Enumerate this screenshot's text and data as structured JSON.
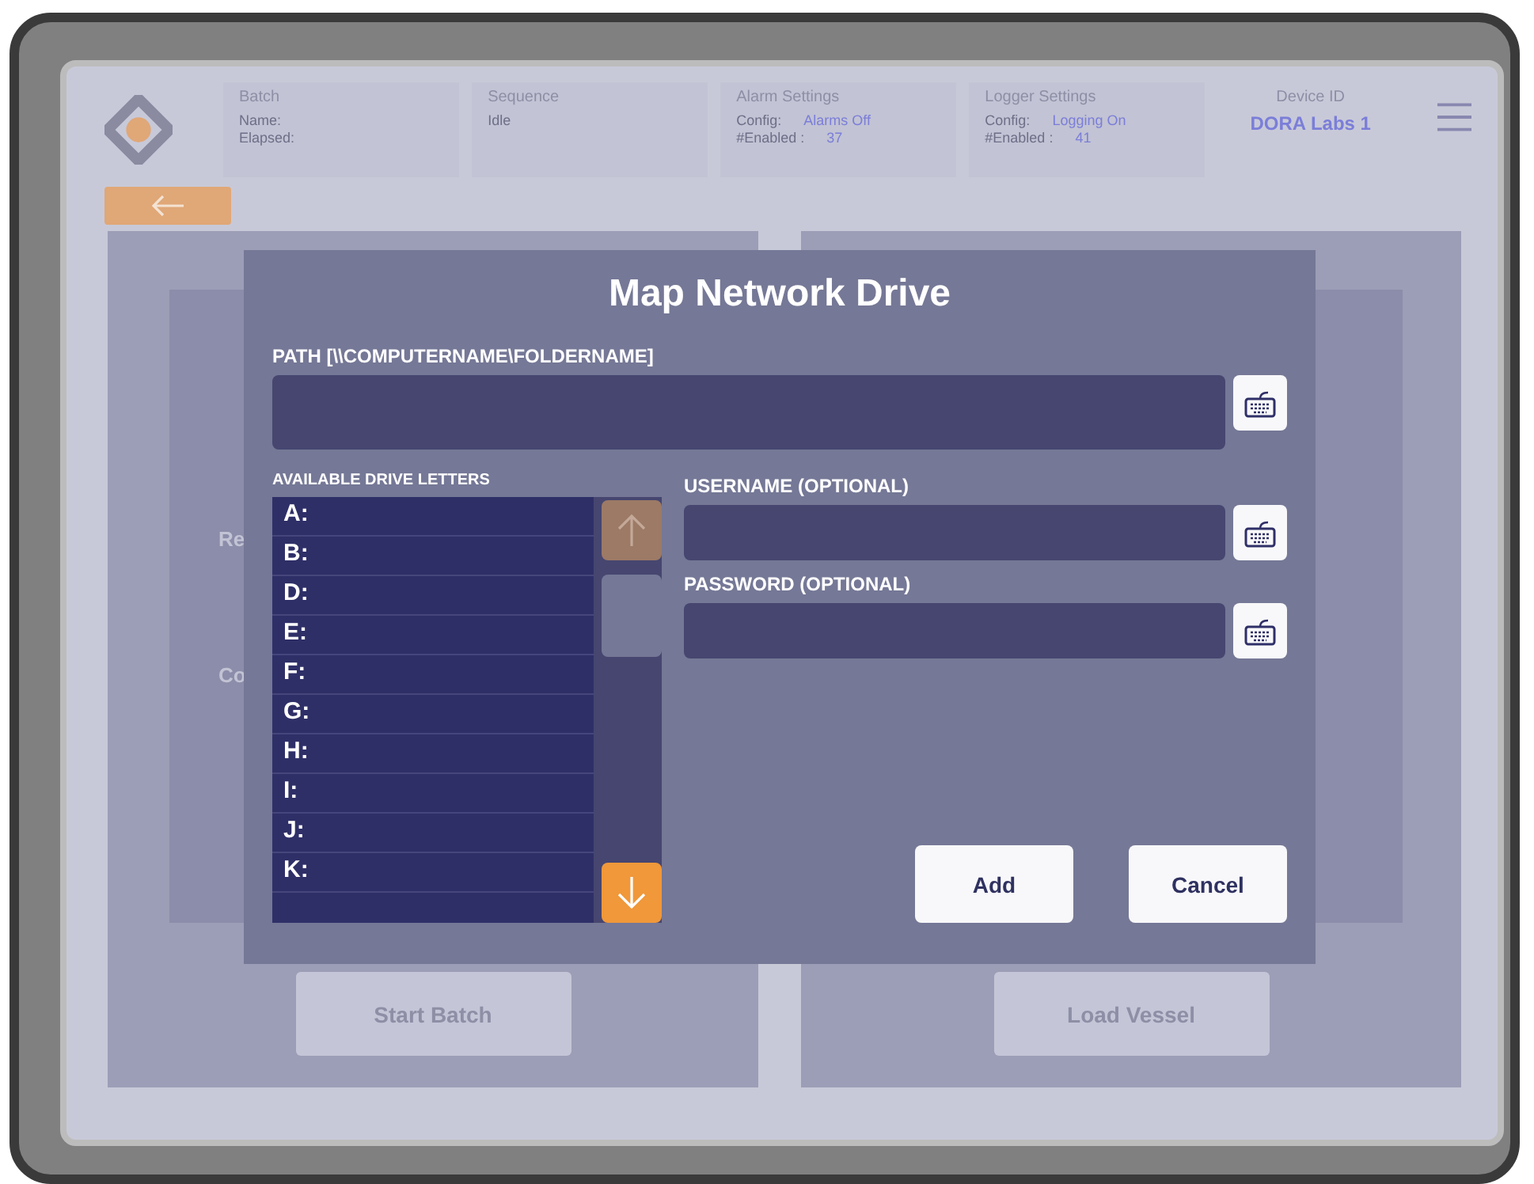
{
  "header": {
    "cards": [
      {
        "title": "Batch",
        "lines": [
          {
            "label": "Name:"
          },
          {
            "label": "Elapsed:"
          }
        ]
      },
      {
        "title": "Sequence",
        "lines": [
          {
            "label": "Idle"
          }
        ]
      },
      {
        "title": "Alarm Settings",
        "lines": [
          {
            "label": "Config:",
            "value": "Alarms Off"
          },
          {
            "label": "#Enabled :",
            "value": "37"
          }
        ]
      },
      {
        "title": "Logger Settings",
        "lines": [
          {
            "label": "Config:",
            "value": "Logging On"
          },
          {
            "label": "#Enabled :",
            "value": "41"
          }
        ]
      }
    ],
    "device": {
      "title": "Device ID",
      "value": "DORA Labs 1"
    }
  },
  "panels": [
    {
      "labels": [
        "Re",
        "Co"
      ],
      "button": "Start Batch"
    },
    {
      "button": "Load Vessel"
    }
  ],
  "dialog": {
    "title": "Map Network Drive",
    "path": {
      "label": "PATH [\\\\COMPUTERNAME\\FOLDERNAME]"
    },
    "drives": {
      "label": "AVAILABLE DRIVE LETTERS",
      "items": [
        "A:",
        "B:",
        "D:",
        "E:",
        "F:",
        "G:",
        "H:",
        "I:",
        "J:",
        "K:"
      ],
      "up_disabled": true,
      "down_disabled": false
    },
    "username": {
      "label": "USERNAME (OPTIONAL)"
    },
    "password": {
      "label": "PASSWORD (OPTIONAL)"
    },
    "buttons": [
      "Add",
      "Cancel"
    ]
  }
}
